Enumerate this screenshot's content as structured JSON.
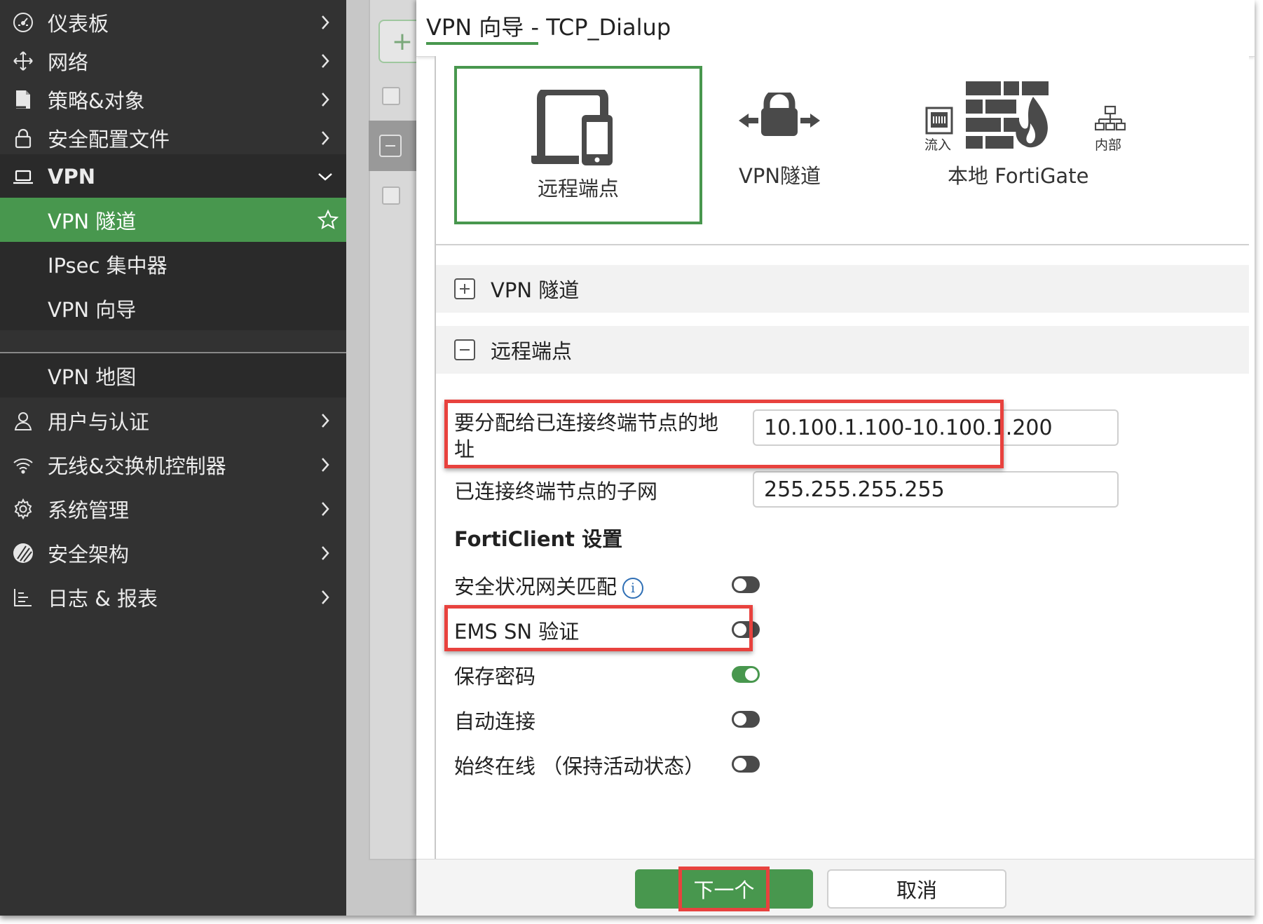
{
  "sidebar": {
    "items": [
      {
        "label": "仪表板"
      },
      {
        "label": "网络"
      },
      {
        "label": "策略&对象"
      },
      {
        "label": "安全配置文件"
      },
      {
        "label": "VPN"
      },
      {
        "label": "VPN 隧道"
      },
      {
        "label": "IPsec 集中器"
      },
      {
        "label": "VPN 向导"
      },
      {
        "label": "VPN 地图"
      },
      {
        "label": "用户与认证"
      },
      {
        "label": "无线&交换机控制器"
      },
      {
        "label": "系统管理"
      },
      {
        "label": "安全架构"
      },
      {
        "label": "日志 & 报表"
      }
    ]
  },
  "dialog": {
    "title": "VPN 向导 - TCP_Dialup",
    "topology": {
      "remote_label": "远程端点",
      "tunnel_label": "VPN隧道",
      "local_label": "本地 FortiGate",
      "inbound_label": "流入",
      "internal_label": "内部"
    },
    "sections": {
      "vpn_tunnel": "VPN 隧道",
      "remote_endpoint": "远程端点"
    },
    "fields": {
      "assign_addr_label_line1": "要分配给已连接终端节点的地",
      "assign_addr_label_line2": "址",
      "assign_addr_value": "10.100.1.100-10.100.1.200",
      "subnet_label": "已连接终端节点的子网",
      "subnet_value": "255.255.255.255"
    },
    "forticlient": {
      "heading": "FortiClient 设置",
      "toggles": [
        {
          "label": "安全状况网关匹配",
          "on": false
        },
        {
          "label": "EMS SN 验证",
          "on": false
        },
        {
          "label": "保存密码",
          "on": true
        },
        {
          "label": "自动连接",
          "on": false
        },
        {
          "label": "始终在线 （保持活动状态）",
          "on": false
        }
      ]
    },
    "buttons": {
      "next": "下一个",
      "cancel": "取消"
    }
  },
  "colors": {
    "accent": "#48974e",
    "sidebar_bg": "#323232",
    "highlight": "#e8423e"
  }
}
